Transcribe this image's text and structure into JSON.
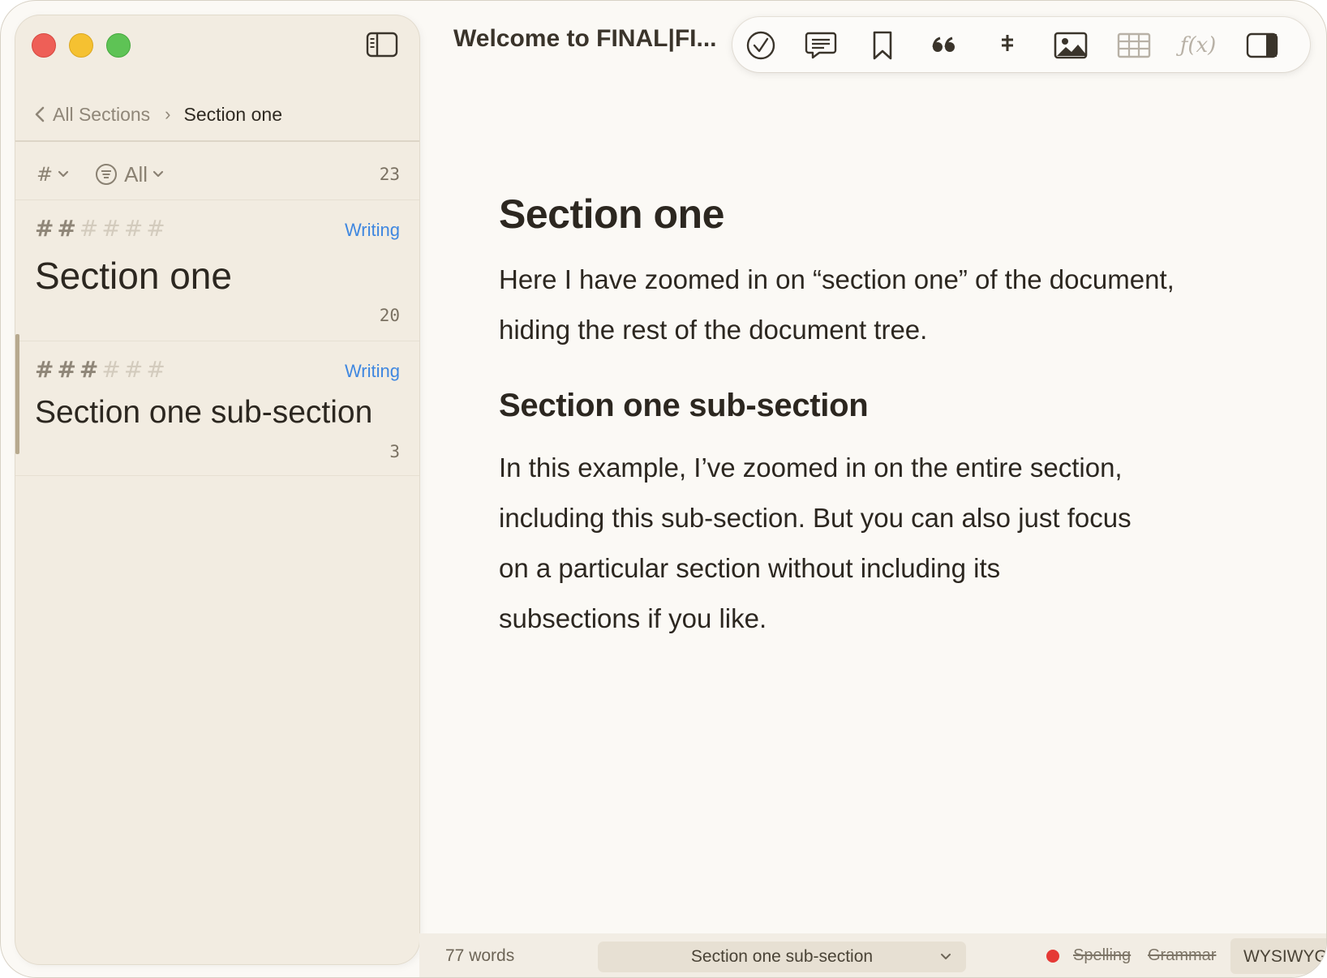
{
  "window": {
    "title": "Welcome to FINAL|FI..."
  },
  "sidebar": {
    "breadcrumb": {
      "parent": "All Sections",
      "separator": "›",
      "current": "Section one"
    },
    "filters": {
      "level_symbol": "#",
      "status_label": "All",
      "total_count": "23"
    },
    "sections": [
      {
        "level": 2,
        "status": "Writing",
        "title": "Section one",
        "count": "20"
      },
      {
        "level": 3,
        "status": "Writing",
        "title": "Section one sub-section",
        "count": "3"
      }
    ]
  },
  "toolbar": {
    "buttons": [
      "task-check-icon",
      "comment-icon",
      "bookmark-icon",
      "quote-icon",
      "footnote-icon",
      "image-icon",
      "table-icon",
      "function-icon",
      "inspector-panel-icon"
    ],
    "function_label": "ƒ(x)"
  },
  "document": {
    "heading1": "Section one",
    "paragraph1": [
      "Here I have zoomed in on “section one” of the document,",
      "hiding the rest of the document tree."
    ],
    "heading2": "Section one sub-section",
    "paragraph2": [
      "In this example, I’ve zoomed in on the entire section,",
      "including this sub-section. But you can also just focus",
      "on a particular section without including its",
      "subsections if you like."
    ]
  },
  "statusbar": {
    "word_count": "77 words",
    "current_section": "Section one sub-section",
    "spelling": "Spelling",
    "grammar": "Grammar",
    "mode": "WYSIWYG"
  },
  "colors": {
    "sidebar_bg": "#f2ece1",
    "editor_bg": "#fbf9f5",
    "status_badge": "#3f87e0",
    "recording_dot": "#e53935"
  }
}
